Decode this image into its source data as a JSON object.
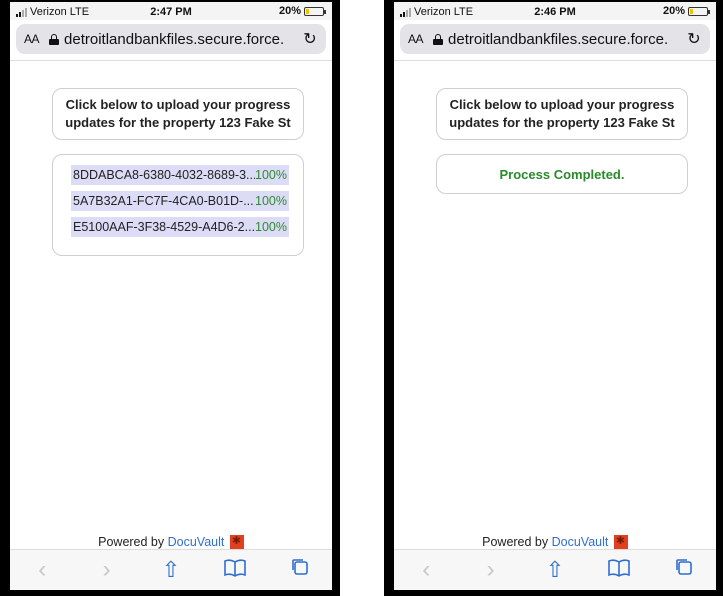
{
  "left": {
    "status": {
      "carrier": "Verizon LTE",
      "time": "2:47 PM",
      "battery": "20%"
    },
    "url": "detroitlandbankfiles.secure.force.",
    "header_line1": "Click below to upload your progress",
    "header_line2": "updates for the property 123 Fake St",
    "files": [
      {
        "name": "8DDABCA8-6380-4032-8689-3...",
        "progress": "100%"
      },
      {
        "name": "5A7B32A1-FC7F-4CA0-B01D-...",
        "progress": "100%"
      },
      {
        "name": "E5100AAF-3F38-4529-A4D6-2...",
        "progress": "100%"
      }
    ],
    "powered_prefix": "Powered by",
    "powered_link": "DocuVault"
  },
  "right": {
    "status": {
      "carrier": "Verizon LTE",
      "time": "2:46 PM",
      "battery": "20%"
    },
    "url": "detroitlandbankfiles.secure.force.",
    "header_line1": "Click below to upload your progress",
    "header_line2": "updates for the property 123 Fake St",
    "completed_message": "Process Completed.",
    "powered_prefix": "Powered by",
    "powered_link": "DocuVault"
  },
  "common": {
    "aa_label": "AA",
    "reload_icon": "↻",
    "battery_level": 0.2,
    "toolbar": {
      "back": "‹",
      "forward": "›",
      "share": "⇧",
      "bookmarks": "📖",
      "tabs": "❐"
    },
    "colors": {
      "accent": "#2f6fd0",
      "success": "#2b8a2b",
      "file_bg": "#dcdcf6"
    }
  }
}
